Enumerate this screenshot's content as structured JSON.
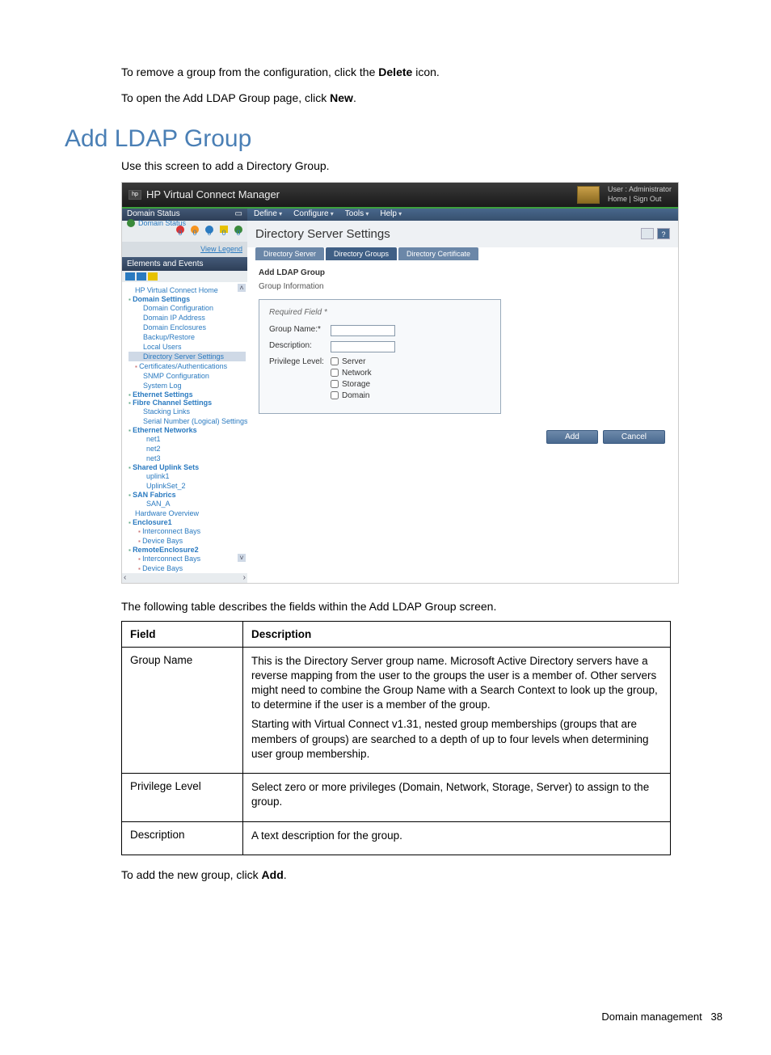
{
  "intro": {
    "p1a": "To remove a group from the configuration, click the ",
    "p1b": "Delete",
    "p1c": " icon.",
    "p2a": "To open the Add LDAP Group page, click ",
    "p2b": "New",
    "p2c": "."
  },
  "heading": "Add LDAP Group",
  "subtext": "Use this screen to add a Directory Group.",
  "app": {
    "title": "HP Virtual Connect Manager",
    "user_label": "User : Administrator",
    "links": {
      "home": "Home",
      "sep": " | ",
      "signout": "Sign Out"
    }
  },
  "sidebar": {
    "domain_status_head": "Domain Status",
    "status_label": "Domain Status",
    "counts": [
      "0",
      "0",
      "0",
      "0",
      "0"
    ],
    "view_legend": "View Legend",
    "elements_head": "Elements and Events",
    "tree": [
      {
        "t": "HP Virtual Connect Home",
        "cls": "item",
        "ind": 8
      },
      {
        "t": "Domain Settings",
        "cls": "cat",
        "ind": 0
      },
      {
        "t": "Domain Configuration",
        "cls": "item",
        "ind": 18
      },
      {
        "t": "Domain IP Address",
        "cls": "item",
        "ind": 18
      },
      {
        "t": "Domain Enclosures",
        "cls": "item",
        "ind": 18
      },
      {
        "t": "Backup/Restore",
        "cls": "item",
        "ind": 18
      },
      {
        "t": "Local Users",
        "cls": "item",
        "ind": 18
      },
      {
        "t": "Directory Server Settings",
        "cls": "item sel",
        "ind": 18
      },
      {
        "t": "Certificates/Authentications",
        "cls": "cat2 item",
        "ind": 8
      },
      {
        "t": "SNMP Configuration",
        "cls": "item",
        "ind": 18
      },
      {
        "t": "System Log",
        "cls": "item",
        "ind": 18
      },
      {
        "t": "Ethernet Settings",
        "cls": "cat",
        "ind": 0
      },
      {
        "t": "Fibre Channel Settings",
        "cls": "cat",
        "ind": 0
      },
      {
        "t": "Stacking Links",
        "cls": "item",
        "ind": 18
      },
      {
        "t": "Serial Number (Logical) Settings",
        "cls": "item",
        "ind": 18
      },
      {
        "t": "Ethernet Networks",
        "cls": "cat",
        "ind": 0
      },
      {
        "t": "net1",
        "cls": "item",
        "ind": 22
      },
      {
        "t": "net2",
        "cls": "item",
        "ind": 22
      },
      {
        "t": "net3",
        "cls": "item",
        "ind": 22
      },
      {
        "t": "Shared Uplink Sets",
        "cls": "cat",
        "ind": 0
      },
      {
        "t": "uplink1",
        "cls": "item",
        "ind": 22
      },
      {
        "t": "UplinkSet_2",
        "cls": "item",
        "ind": 22
      },
      {
        "t": "SAN Fabrics",
        "cls": "cat",
        "ind": 0
      },
      {
        "t": "SAN_A",
        "cls": "item",
        "ind": 22
      },
      {
        "t": "Hardware Overview",
        "cls": "item",
        "ind": 8
      },
      {
        "t": "Enclosure1",
        "cls": "cat",
        "ind": 0
      },
      {
        "t": "Interconnect Bays",
        "cls": "cat2 item",
        "ind": 12
      },
      {
        "t": "Device Bays",
        "cls": "cat2 item",
        "ind": 12
      },
      {
        "t": "RemoteEnclosure2",
        "cls": "cat",
        "ind": 0
      },
      {
        "t": "Interconnect Bays",
        "cls": "cat2 item",
        "ind": 12
      },
      {
        "t": "Device Bays",
        "cls": "cat2 item",
        "ind": 12
      }
    ]
  },
  "menubar": [
    "Define",
    "Configure",
    "Tools",
    "Help"
  ],
  "panel": {
    "title": "Directory Server Settings",
    "tabs": [
      "Directory Server",
      "Directory Groups",
      "Directory Certificate"
    ],
    "active_tab": 1,
    "form_title": "Add LDAP Group",
    "form_sub": "Group Information",
    "required": "Required Field *",
    "group_name_label": "Group Name:*",
    "description_label": "Description:",
    "privilege_label": "Privilege Level:",
    "privs": [
      "Server",
      "Network",
      "Storage",
      "Domain"
    ],
    "add": "Add",
    "cancel": "Cancel"
  },
  "table_intro": "The following table describes the fields within the Add LDAP Group screen.",
  "table": {
    "h1": "Field",
    "h2": "Description",
    "rows": [
      {
        "f": "Group Name",
        "d1": "This is the Directory Server group name. Microsoft Active Directory servers have a reverse mapping from the user to the groups the user is a member of. Other servers might need to combine the Group Name with a Search Context to look up the group, to determine if the user is a member of the group.",
        "d2": "Starting with Virtual Connect v1.31, nested group memberships (groups that are members of groups) are searched to a depth of up to four levels when determining user group membership."
      },
      {
        "f": "Privilege Level",
        "d1": "Select zero or more privileges (Domain, Network, Storage, Server) to assign to the group.",
        "d2": ""
      },
      {
        "f": "Description",
        "d1": "A text description for the group.",
        "d2": ""
      }
    ]
  },
  "after_a": "To add the new group, click ",
  "after_b": "Add",
  "after_c": ".",
  "footer": {
    "section": "Domain management",
    "page": "38"
  }
}
